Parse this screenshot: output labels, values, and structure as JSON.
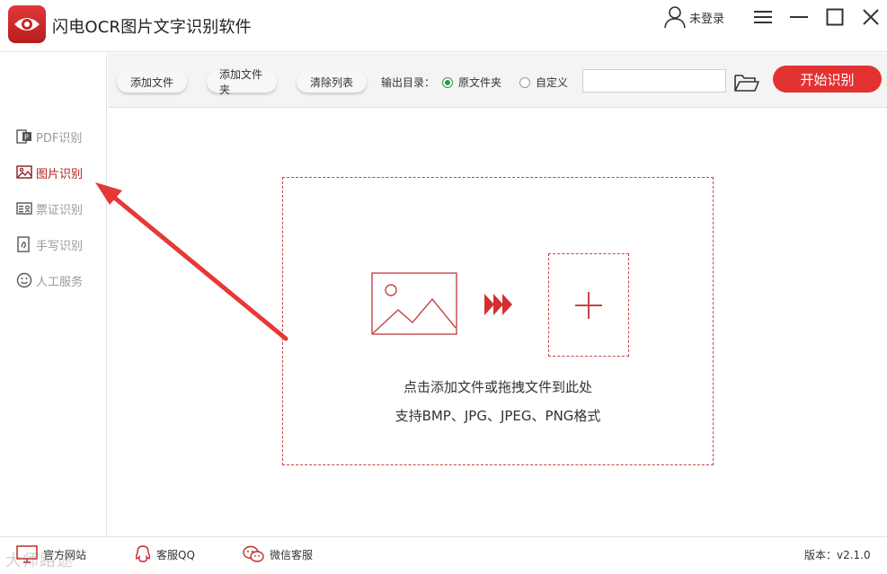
{
  "app": {
    "title": "闪电OCR图片文字识别软件",
    "user_label": "未登录"
  },
  "sidebar": {
    "items": [
      {
        "label": "PDF识别",
        "icon": "pdf-icon",
        "active": false
      },
      {
        "label": "图片识别",
        "icon": "image-icon",
        "active": true
      },
      {
        "label": "票证识别",
        "icon": "id-card-icon",
        "active": false
      },
      {
        "label": "手写识别",
        "icon": "handwriting-icon",
        "active": false
      },
      {
        "label": "人工服务",
        "icon": "smiley-icon",
        "active": false
      }
    ]
  },
  "toolbar": {
    "add_file": "添加文件",
    "add_folder": "添加文件夹",
    "clear_list": "清除列表",
    "output_label": "输出目录：",
    "radio_original": "原文件夹",
    "radio_custom": "自定义",
    "selected_output": "原文件夹",
    "path_value": "",
    "start": "开始识别"
  },
  "dropzone": {
    "hint": "点击添加文件或拖拽文件到此处",
    "formats": "支持BMP、JPG、JPEG、PNG格式"
  },
  "footer": {
    "website": "官方网站",
    "qq": "客服QQ",
    "wechat": "微信客服",
    "version": "版本：v2.1.0",
    "watermark": "大师路途"
  },
  "colors": {
    "accent": "#e33232",
    "active_text": "#b71c1c",
    "radio_selected": "#2e9b3d",
    "annotation": "#e53935"
  }
}
